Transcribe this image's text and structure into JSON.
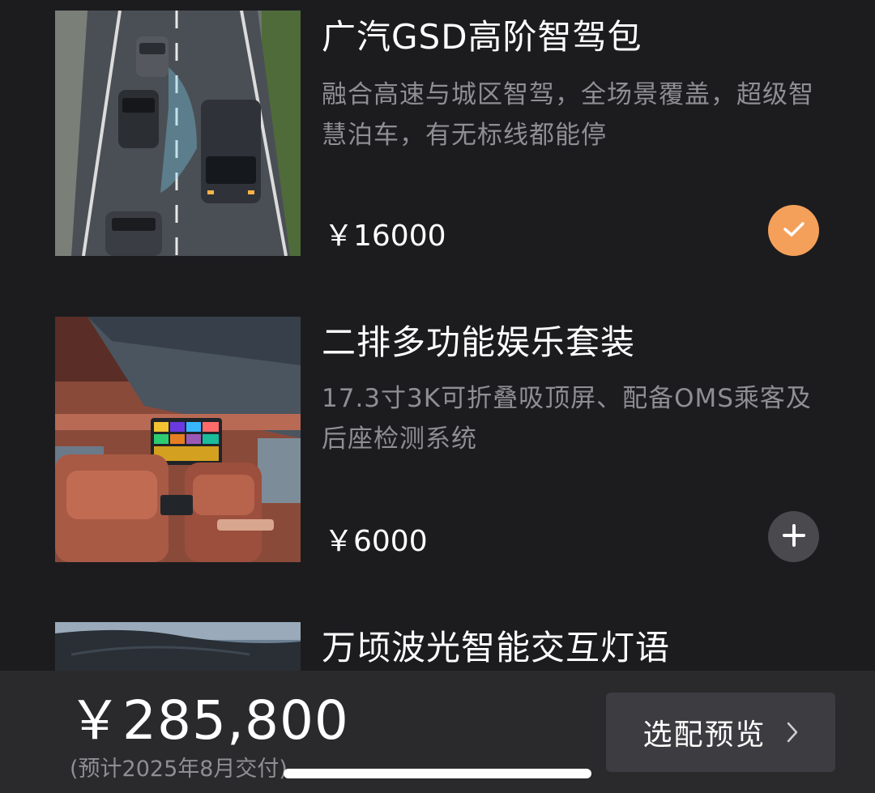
{
  "options": [
    {
      "title": "广汽GSD高阶智驾包",
      "description": "融合高速与城区智驾，全场景覆盖，超级智慧泊车，有无标线都能停",
      "price": "￥16000",
      "selected": true,
      "image": "highway-cars-image"
    },
    {
      "title": "二排多功能娱乐套装",
      "description": "17.3寸3K可折叠吸顶屏、配备OMS乘客及后座检测系统",
      "price": "￥6000",
      "selected": false,
      "image": "car-interior-image"
    },
    {
      "title": "万顷波光智能交互灯语",
      "image": "car-hood-image"
    }
  ],
  "icons": {
    "selected": "check-icon",
    "add": "plus-icon",
    "chevron": "chevron-right-icon"
  },
  "bottom_bar": {
    "total_price": "￥285,800",
    "delivery_note": "(预计2025年8月交付)",
    "preview_label": "选配预览"
  },
  "colors": {
    "background": "#1c1c1f",
    "accent": "#f4a05a",
    "bottom_bar": "#2a2a2d",
    "button": "#3d3d41",
    "muted_text": "#8e8e93"
  }
}
